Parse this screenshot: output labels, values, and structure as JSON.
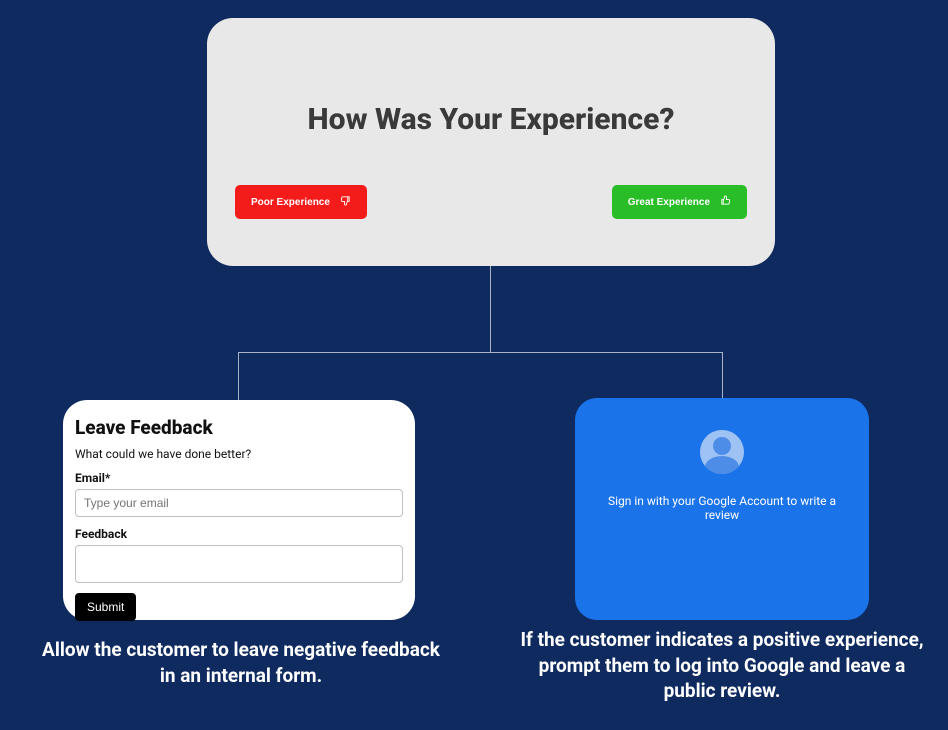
{
  "header": {
    "title": "How Was Your Experience?"
  },
  "buttons": {
    "poor": "Poor Experience",
    "great": "Great Experience"
  },
  "feedback": {
    "title": "Leave Feedback",
    "subtitle": "What could we have done better?",
    "email_label": "Email*",
    "email_placeholder": "Type your email",
    "feedback_label": "Feedback",
    "submit": "Submit"
  },
  "google": {
    "prompt": "Sign in with your Google Account to write a review"
  },
  "captions": {
    "left": "Allow the customer to leave negative feedback in an internal form.",
    "right": "If the customer indicates a positive experience, prompt them to log into Google and leave a public review."
  }
}
